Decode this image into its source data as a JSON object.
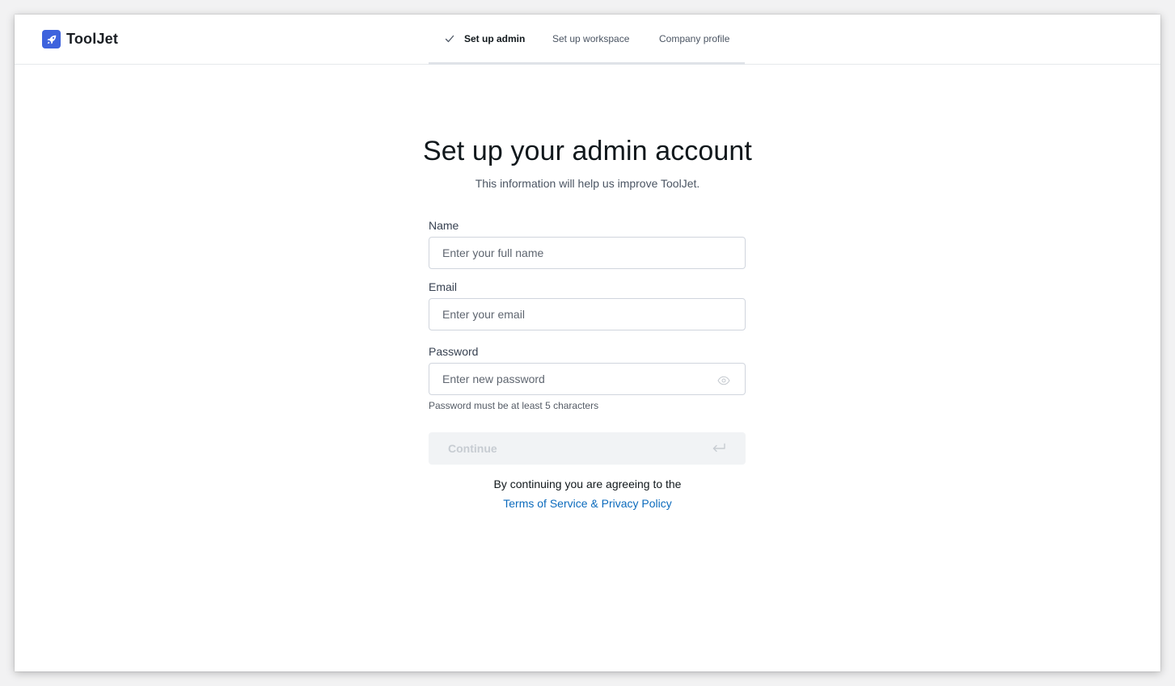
{
  "app": {
    "brand_name": "ToolJet",
    "brand_icon": "rocket-icon",
    "accent_color": "#3e63dd"
  },
  "steps": [
    {
      "label": "Set up admin",
      "state": "active",
      "icon": "check-icon"
    },
    {
      "label": "Set up workspace",
      "state": "pending"
    },
    {
      "label": "Company profile",
      "state": "pending"
    }
  ],
  "page": {
    "title": "Set up your admin account",
    "subtitle": "This information will help us improve ToolJet."
  },
  "form": {
    "name": {
      "label": "Name",
      "placeholder": "Enter your full name",
      "value": ""
    },
    "email": {
      "label": "Email",
      "placeholder": "Enter your email",
      "value": ""
    },
    "password": {
      "label": "Password",
      "placeholder": "Enter new password",
      "value": "",
      "toggle_icon": "eye-icon",
      "hint": "Password must be at least 5 characters"
    },
    "continue_button": {
      "label": "Continue",
      "icon": "enter-icon",
      "disabled": true
    }
  },
  "legal": {
    "agree_text": "By continuing you are agreeing to the",
    "terms_link": "Terms of Service & Privacy Policy",
    "link_color": "#0c6bbd"
  }
}
